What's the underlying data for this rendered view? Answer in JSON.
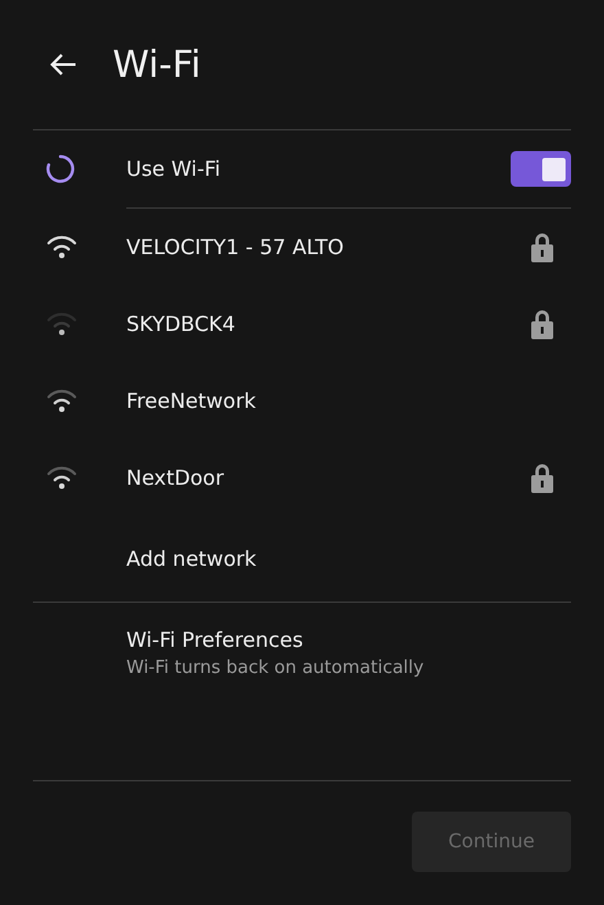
{
  "header": {
    "title": "Wi-Fi"
  },
  "wifi_toggle": {
    "label": "Use Wi-Fi",
    "on": true
  },
  "networks": [
    {
      "name": "VELOCITY1 - 57 ALTO",
      "kind": "strong",
      "locked": true
    },
    {
      "name": "SKYDBCK4",
      "kind": "weak",
      "locked": true
    },
    {
      "name": "FreeNetwork",
      "kind": "medium",
      "locked": false
    },
    {
      "name": "NextDoor",
      "kind": "medium",
      "locked": true
    }
  ],
  "add_network": {
    "label": "Add network"
  },
  "preferences": {
    "title": "Wi-Fi Preferences",
    "subtitle": "Wi-Fi turns back on automatically"
  },
  "continue_button": {
    "label": "Continue",
    "disabled": true
  }
}
